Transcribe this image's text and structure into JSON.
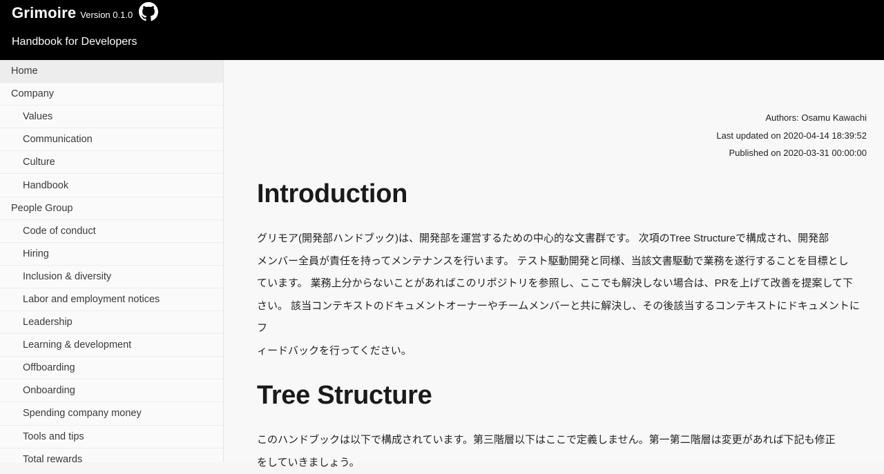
{
  "header": {
    "brand": "Grimoire",
    "version": "Version 0.1.0",
    "subtitle": "Handbook for Developers",
    "github_icon": "github-icon"
  },
  "sidebar": {
    "items": [
      {
        "label": "Home",
        "level": 1,
        "active": true
      },
      {
        "label": "Company",
        "level": 1
      },
      {
        "label": "Values",
        "level": 2
      },
      {
        "label": "Communication",
        "level": 2
      },
      {
        "label": "Culture",
        "level": 2
      },
      {
        "label": "Handbook",
        "level": 2
      },
      {
        "label": "People Group",
        "level": 1
      },
      {
        "label": "Code of conduct",
        "level": 2
      },
      {
        "label": "Hiring",
        "level": 2
      },
      {
        "label": "Inclusion & diversity",
        "level": 2
      },
      {
        "label": "Labor and employment notices",
        "level": 2
      },
      {
        "label": "Leadership",
        "level": 2
      },
      {
        "label": "Learning & development",
        "level": 2
      },
      {
        "label": "Offboarding",
        "level": 2
      },
      {
        "label": "Onboarding",
        "level": 2
      },
      {
        "label": "Spending company money",
        "level": 2
      },
      {
        "label": "Tools and tips",
        "level": 2
      },
      {
        "label": "Total rewards",
        "level": 2
      }
    ]
  },
  "meta": {
    "authors": "Authors: Osamu Kawachi",
    "updated": "Last updated on 2020-04-14 18:39:52",
    "published": "Published on 2020-03-31 00:00:00"
  },
  "article": {
    "intro_title": "Introduction",
    "intro_lines": [
      "グリモア(開発部ハンドブック)は、開発部を運営するための中心的な文書群です。 次項のTree Structureで構成され、開発部",
      "メンバー全員が責任を持ってメンテナンスを行います。 テスト駆動開発と同様、当該文書駆動で業務を遂行することを目標とし",
      "ています。 業務上分からないことがあればこのリポジトリを参照し、ここでも解決しない場合は、PRを上げて改善を提案して下",
      "さい。 該当コンテキストのドキュメントオーナーやチームメンバーと共に解決し、その後該当するコンテキストにドキュメントにフ",
      "ィードバックを行ってください。"
    ],
    "tree_title": "Tree Structure",
    "tree_lines": [
      "このハンドブックは以下で構成されています。第三階層以下はここで定義しません。第一第二階層は変更があれば下記も修正",
      "をしていきましょう。"
    ]
  }
}
